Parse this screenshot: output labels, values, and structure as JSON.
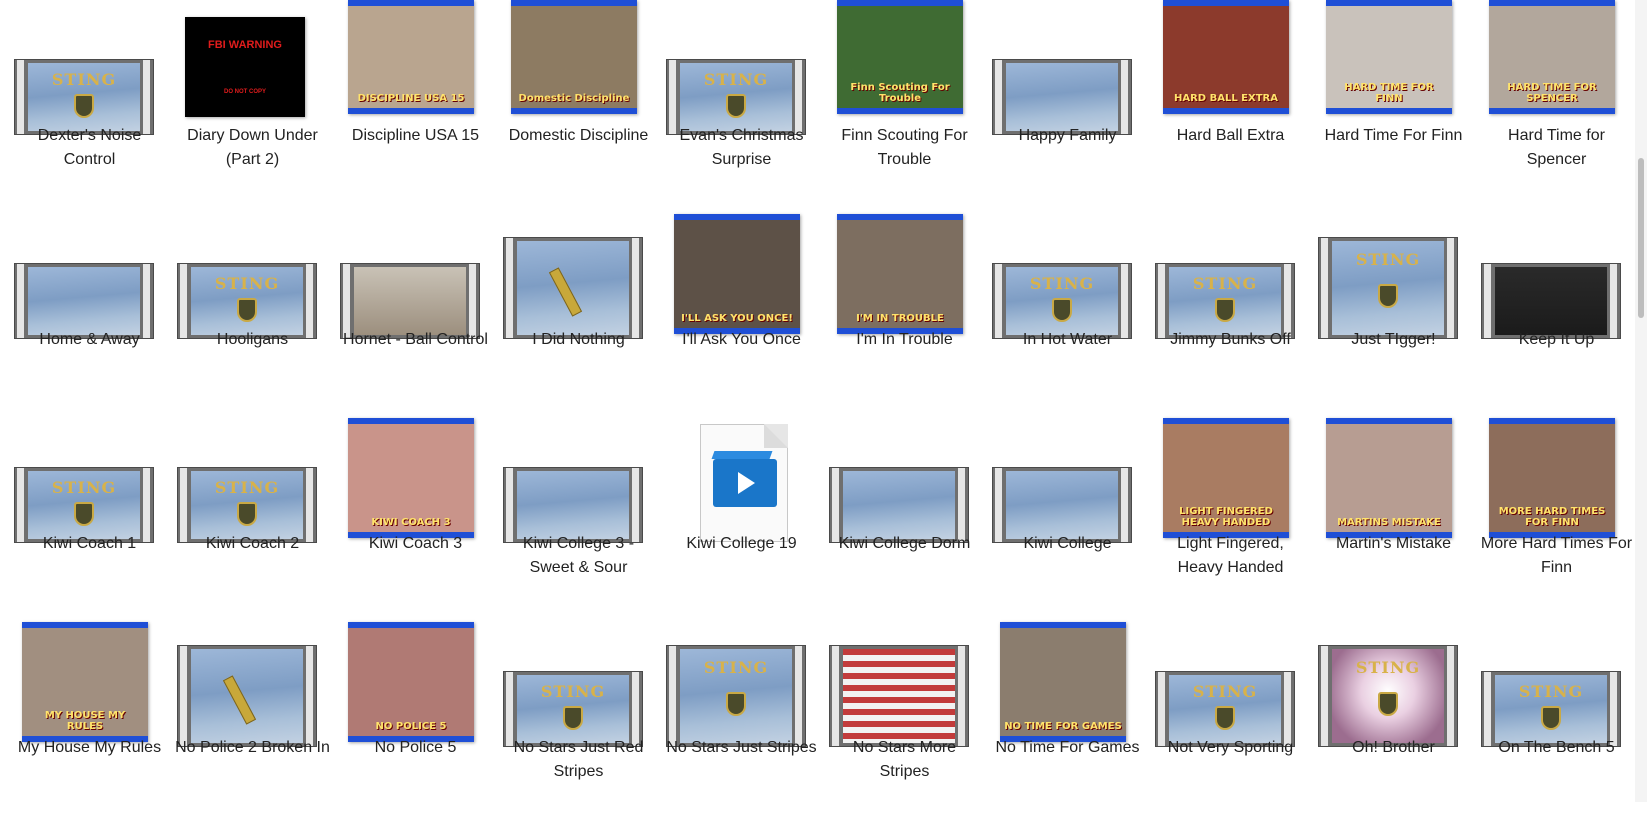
{
  "files": [
    {
      "name": "Dexter's Noise Control",
      "thumb": "film",
      "frame": "sky",
      "logo": "STING"
    },
    {
      "name": "Diary Down Under (Part 2)",
      "thumb": "black-poster",
      "poster_title": "FBI WARNING",
      "poster_subtitle": "DO NOT COPY"
    },
    {
      "name": "Discipline USA 15",
      "thumb": "poster",
      "poster_caption": "DISCIPLINE USA 15",
      "bg": "#b9a58f"
    },
    {
      "name": "Domestic Discipline",
      "thumb": "poster",
      "poster_caption": "Domestic Discipline",
      "bg": "#8d7b62"
    },
    {
      "name": "Evan's Christmas Surprise",
      "thumb": "film",
      "frame": "sky",
      "logo": "STING"
    },
    {
      "name": "Finn Scouting For Trouble",
      "thumb": "poster",
      "poster_caption": "Finn Scouting For Trouble",
      "bg": "#3f6b33"
    },
    {
      "name": "Happy Family",
      "thumb": "film",
      "frame": "sky",
      "logo": ""
    },
    {
      "name": "Hard Ball Extra",
      "thumb": "poster-film",
      "poster_caption": "HARD BALL EXTRA",
      "bg": "#8c3a2c"
    },
    {
      "name": "Hard Time For Finn",
      "thumb": "poster",
      "poster_caption": "HARD TIME FOR FINN",
      "bg": "#c9c2bb"
    },
    {
      "name": "Hard Time for Spencer",
      "thumb": "poster",
      "poster_caption": "HARD TIME FOR SPENCER",
      "bg": "#b2a79c"
    },
    {
      "name": "Home & Away",
      "thumb": "film",
      "frame": "sky",
      "logo": ""
    },
    {
      "name": "Hooligans",
      "thumb": "film",
      "frame": "sky",
      "logo": "STING"
    },
    {
      "name": "Hornet - Ball Control",
      "thumb": "film",
      "frame": "room",
      "logo": ""
    },
    {
      "name": "I Did Nothing",
      "thumb": "film-tall",
      "frame": "sky-tube",
      "logo": ""
    },
    {
      "name": "I'll Ask You Once",
      "thumb": "poster",
      "poster_caption": "I'LL ASK YOU ONCE!",
      "bg": "#5d5147"
    },
    {
      "name": "I'm In Trouble",
      "thumb": "poster",
      "poster_caption": "I'M IN TROUBLE",
      "bg": "#7d6e60"
    },
    {
      "name": "In Hot Water",
      "thumb": "film",
      "frame": "sky",
      "logo": "STING"
    },
    {
      "name": "Jimmy Bunks Off",
      "thumb": "film",
      "frame": "sky",
      "logo": "STING"
    },
    {
      "name": "Just TIgger!",
      "thumb": "film-tall",
      "frame": "sky",
      "logo": "STING"
    },
    {
      "name": "Keep It Up",
      "thumb": "film",
      "frame": "dark",
      "logo": ""
    },
    {
      "name": "Kiwi Coach 1",
      "thumb": "film",
      "frame": "sky",
      "logo": "STING"
    },
    {
      "name": "Kiwi Coach 2",
      "thumb": "film",
      "frame": "sky",
      "logo": "STING"
    },
    {
      "name": "Kiwi Coach 3",
      "thumb": "poster",
      "poster_caption": "KIWI COACH 3",
      "bg": "#c9948a"
    },
    {
      "name": "Kiwi College 3 - Sweet & Sour",
      "thumb": "film",
      "frame": "sky",
      "logo": ""
    },
    {
      "name": "Kiwi College 19",
      "thumb": "doc"
    },
    {
      "name": "Kiwi College Dorm",
      "thumb": "film",
      "frame": "sky",
      "logo": ""
    },
    {
      "name": "Kiwi College",
      "thumb": "film",
      "frame": "sky",
      "logo": ""
    },
    {
      "name": "Light Fingered, Heavy Handed",
      "thumb": "poster",
      "poster_caption": "LIGHT FINGERED HEAVY HANDED",
      "bg": "#a97c62"
    },
    {
      "name": "Martin's Mistake",
      "thumb": "poster",
      "poster_caption": "MARTINS MISTAKE",
      "bg": "#b79d92"
    },
    {
      "name": "More Hard Times For Finn",
      "thumb": "poster",
      "poster_caption": "MORE HARD TIMES FOR FINN",
      "bg": "#8d6d5b"
    },
    {
      "name": "My House My Rules",
      "thumb": "poster",
      "poster_caption": "MY HOUSE MY RULES",
      "bg": "#a18f80"
    },
    {
      "name": "No Police 2 Broken In",
      "thumb": "film-tall",
      "frame": "sky-tube",
      "logo": ""
    },
    {
      "name": "No Police 5",
      "thumb": "poster",
      "poster_caption": "NO POLICE 5",
      "bg": "#b07a74"
    },
    {
      "name": "No Stars Just Red Stripes",
      "thumb": "film",
      "frame": "sky",
      "logo": "STING"
    },
    {
      "name": "No Stars Just Stripes",
      "thumb": "film-tall",
      "frame": "sky",
      "logo": "STING"
    },
    {
      "name": "No Stars More Stripes",
      "thumb": "film-tall",
      "frame": "flag",
      "logo": ""
    },
    {
      "name": "No Time For Games",
      "thumb": "poster",
      "poster_caption": "NO TIME FOR GAMES",
      "bg": "#8b7d6e"
    },
    {
      "name": "Not Very Sporting",
      "thumb": "film",
      "frame": "sky",
      "logo": "STING"
    },
    {
      "name": "Oh! Brother",
      "thumb": "film-tall",
      "frame": "pink",
      "logo": "STING"
    },
    {
      "name": "On The Bench 5",
      "thumb": "film",
      "frame": "sky",
      "logo": "STING"
    }
  ]
}
